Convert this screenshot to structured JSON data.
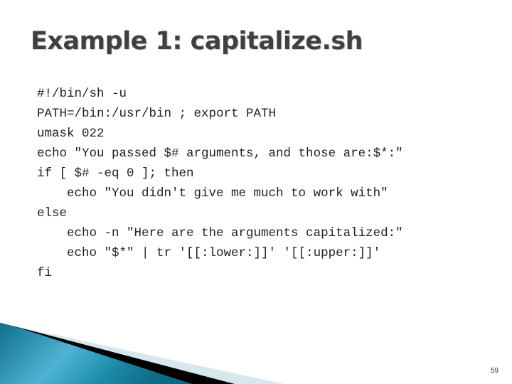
{
  "slide": {
    "title": "Example 1: capitalize.sh",
    "code_lines": [
      "#!/bin/sh -u",
      "PATH=/bin:/usr/bin ; export PATH",
      "umask 022",
      "echo \"You passed $# arguments, and those are:$*:\"",
      "if [ $# -eq 0 ]; then",
      "    echo \"You didn't give me much to work with\"",
      "else",
      "    echo -n \"Here are the arguments capitalized:\"",
      "    echo \"$*\" | tr '[[:lower:]]' '[[:upper:]]'",
      "fi"
    ],
    "page_number": "59",
    "colors": {
      "title": "#404040",
      "accent_teal": "#1a8aa8",
      "accent_light": "#d6e8ee"
    }
  }
}
